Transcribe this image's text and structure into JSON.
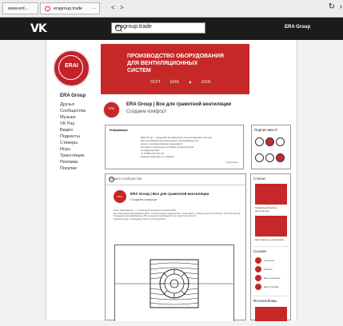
{
  "browser": {
    "tabs": [
      {
        "label": "www.ent..."
      },
      {
        "label": "eragroup.trade",
        "more": "···"
      }
    ],
    "nav": {
      "back": "<",
      "forward": ">"
    },
    "reload_icon": "reload-icon",
    "close_icon": "close-icon"
  },
  "header": {
    "logo": "VK",
    "search_value": "eragroup.trade",
    "user": "ERA Group"
  },
  "sidebar": {
    "name": "ERA Group",
    "logo_text": "ERAI",
    "menu": [
      "Друзья",
      "Сообщества",
      "Музыка",
      "VK Pay",
      "Видео",
      "Подкасты",
      "Стикеры",
      "Игры",
      "Трансляции",
      "Реклама",
      "Покупки"
    ]
  },
  "banner": {
    "lines": [
      "ПРОИЗВОДСТВО ОБОРУДОВАНИЯ",
      "ДЛЯ ВЕНТИЛЯЦИОННЫХ",
      "СИСТЕМ"
    ],
    "logos": "DOIT ERA ▲ ERA"
  },
  "group": {
    "title": "ERA Group | Все для грамотной вентиляции",
    "status": "Создаем комфорт",
    "avatar_text": "ERA"
  },
  "info": {
    "title": "Информация",
    "lines": [
      "ERA Group — ведущий производитель вентиляционных систем.",
      "Мы производим вентиляционное оборудование для",
      "жилых и промышленных помещений.",
      "Оптовые и розничные поставки по всей России.",
      "⊕ eragroup.trade",
      "☏ 8 800 XXX-XX-XX",
      "Нижний Новгород, ул. Ларина"
    ],
    "more": "Подробнее"
  },
  "subscribers": {
    "title": "Подписчики 9"
  },
  "feed": {
    "search_placeholder": "Записи сообщества",
    "post_title": "ERA Group | Все для грамотной вентиляции",
    "post_status": "Создаем комфорт",
    "post_avatar_text": "ERA",
    "post_text": [
      "Наши предложения — лучшие вентиляционные решения ERA",
      "Мы предлагаем оборудование ERA с оптимальными показателями: тихая работа, низкое энергопотребление, простой монтаж.",
      "Продукция сертифицирована. Вся продукция производится на территории России.",
      "Напишите нам, и менеджер ответит на все вопросы."
    ]
  },
  "right": {
    "block_title": "Статьи",
    "caption1": "Правильный выбор вентилятора",
    "caption2": "Как правильно установить",
    "contacts_title": "Ссылки",
    "contacts": [
      "Контакты",
      "Каталог",
      "Мы в соцсетях",
      "Мы в Youtube"
    ],
    "photos_title": "Фотоальбомы"
  }
}
